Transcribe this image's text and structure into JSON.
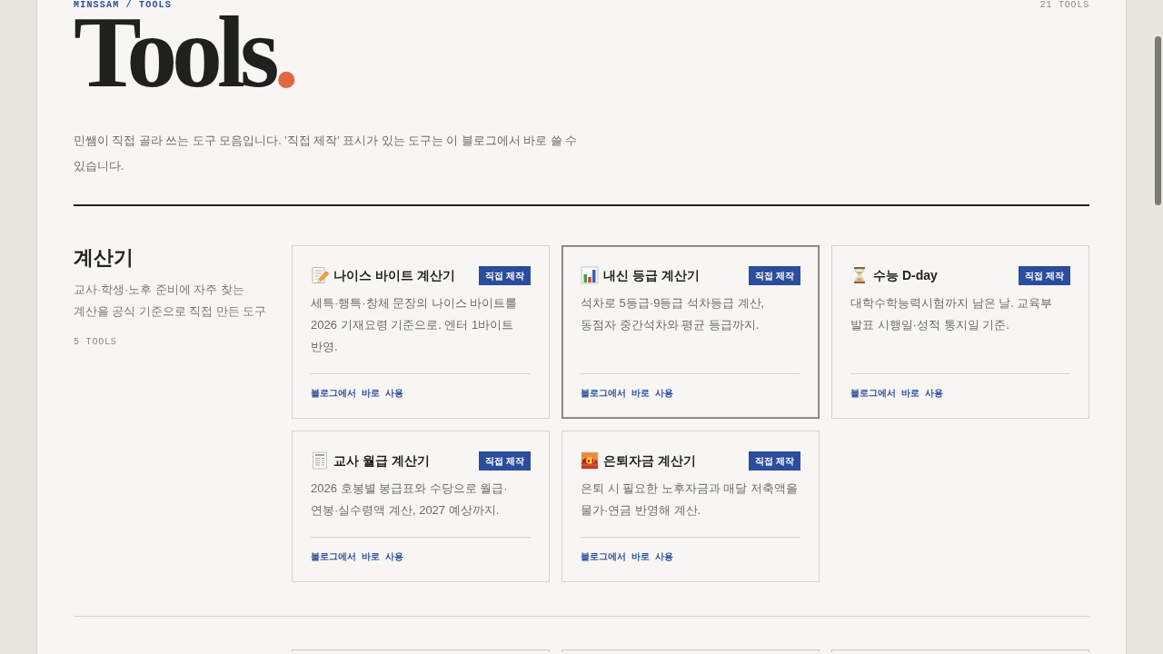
{
  "breadcrumb": "MINSSAM / TOOLS",
  "tool_count": "21 TOOLS",
  "title": "Tools",
  "title_dot": ".",
  "intro": "민쌤이 직접 골라 쓰는 도구 모음입니다. '직접 제작' 표시가 있는 도구는 이 블로그에서 바로 쓸 수 있습니다.",
  "sections": [
    {
      "heading": "계산기",
      "description": "교사·학생·노후 준비에 자주 찾는 계산을 공식 기준으로 직접 만든 도구",
      "count": "5 TOOLS",
      "tools": [
        {
          "name": "나이스 바이트 계산기",
          "badge": "직접 제작",
          "description": "세특·행특·창체 문장의 나이스 바이트를 2026 기재요령 기준으로. 엔터 1바이트 반영.",
          "link": "블로그에서 바로 사용",
          "hovered": false
        },
        {
          "name": "내신 등급 계산기",
          "badge": "직접 제작",
          "description": "석차로 5등급·9등급 석차등급 계산, 동점자 중간석차와 평균 등급까지.",
          "link": "블로그에서 바로 사용",
          "hovered": true
        },
        {
          "name": "수능 D-day",
          "badge": "직접 제작",
          "description": "대학수학능력시험까지 남은 날. 교육부 발표 시행일·성적 통지일 기준.",
          "link": "블로그에서 바로 사용",
          "hovered": false
        },
        {
          "name": "교사 월급 계산기",
          "badge": "직접 제작",
          "description": "2026 호봉별 봉급표와 수당으로 월급·연봉·실수령액 계산, 2027 예상까지.",
          "link": "블로그에서 바로 사용",
          "hovered": false
        },
        {
          "name": "은퇴자금 계산기",
          "badge": "직접 제작",
          "description": "은퇴 시 필요한 노후자금과 매달 저축액을 물가·연금 반영해 계산.",
          "link": "블로그에서 바로 사용",
          "hovered": false
        }
      ]
    }
  ]
}
